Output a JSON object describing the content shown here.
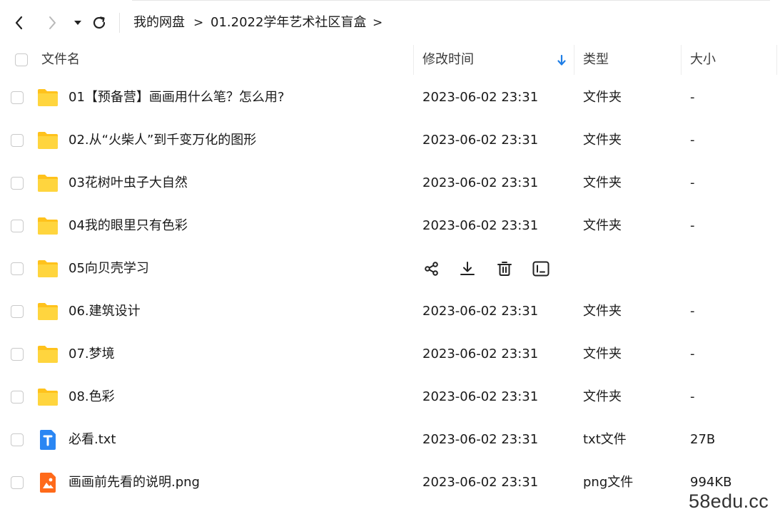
{
  "nav": {
    "back_icon": "chevron-left-icon",
    "forward_icon": "chevron-right-icon",
    "dropdown_icon": "caret-down-icon",
    "refresh_icon": "refresh-icon",
    "breadcrumb": [
      {
        "label": "我的网盘"
      },
      {
        "label": "01.2022学年艺术社区盲盒"
      }
    ],
    "separator": ">"
  },
  "header": {
    "name": "文件名",
    "modified": "修改时间",
    "type": "类型",
    "size": "大小",
    "sort_icon": "arrow-down-icon",
    "sort_color": "#1f7ee6"
  },
  "rows": [
    {
      "name": "01【预备营】画画用什么笔？怎么用?",
      "date": "2023-06-02 23:31",
      "type": "文件夹",
      "size": "-",
      "icon": "folder-icon"
    },
    {
      "name": "02.从“火柴人”到千变万化的图形",
      "date": "2023-06-02 23:31",
      "type": "文件夹",
      "size": "-",
      "icon": "folder-icon"
    },
    {
      "name": "03花树叶虫子大自然",
      "date": "2023-06-02 23:31",
      "type": "文件夹",
      "size": "-",
      "icon": "folder-icon"
    },
    {
      "name": "04我的眼里只有色彩",
      "date": "2023-06-02 23:31",
      "type": "文件夹",
      "size": "-",
      "icon": "folder-icon"
    },
    {
      "name": "05向贝壳学习",
      "date": "",
      "type": "",
      "size": "",
      "icon": "folder-icon",
      "hovered": true
    },
    {
      "name": "06.建筑设计",
      "date": "2023-06-02 23:31",
      "type": "文件夹",
      "size": "-",
      "icon": "folder-icon"
    },
    {
      "name": "07.梦境",
      "date": "2023-06-02 23:31",
      "type": "文件夹",
      "size": "-",
      "icon": "folder-icon"
    },
    {
      "name": "08.色彩",
      "date": "2023-06-02 23:31",
      "type": "文件夹",
      "size": "-",
      "icon": "folder-icon"
    },
    {
      "name": "必看.txt",
      "date": "2023-06-02 23:31",
      "type": "txt文件",
      "size": "27B",
      "icon": "txt-file-icon"
    },
    {
      "name": "画画前先看的说明.png",
      "date": "2023-06-02 23:31",
      "type": "png文件",
      "size": "994KB",
      "icon": "image-file-icon"
    }
  ],
  "row_actions": [
    "share-icon",
    "download-icon",
    "delete-icon",
    "rename-icon"
  ],
  "colors": {
    "folder": "#ffd53e",
    "folder_back": "#ffc21c",
    "txt": "#2a86f3",
    "png": "#ff6a1a"
  },
  "watermark": "58edu.cc"
}
